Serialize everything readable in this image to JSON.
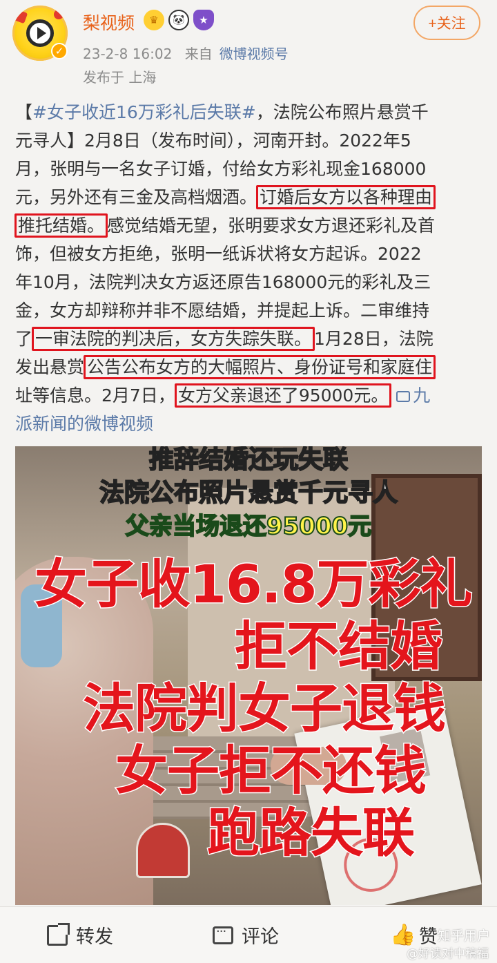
{
  "header": {
    "account_name": "梨视频",
    "verified_mark": "✓",
    "badge_icons": [
      "crown-icon",
      "panda-icon",
      "shield-icon"
    ],
    "timestamp": "23-2-8 16:02",
    "source_prefix": "来自",
    "source": "微博视频号",
    "location": "发布于 上海",
    "follow_label": "+关注"
  },
  "post": {
    "line1_pre": "【",
    "line1_tag": "#女子收近16万彩礼后失联#",
    "line1_post": "，法院公布照片悬赏千",
    "line2": "元寻人】2月8日（发布时间），河南开封。2022年5",
    "line3": "月，张明与一名女子订婚，付给女方彩礼现金168000",
    "line4_pre": "元，另外还有三金及高档烟酒。",
    "line4_hl": "订婚后女方以各种理由",
    "line5_hl": "推托结婚。",
    "line5_post": "感觉结婚无望，张明要求女方退还彩礼及首",
    "line6": "饰，但被女方拒绝，张明一纸诉状将女方起诉。2022",
    "line7": "年10月，法院判决女方返还原告168000元的彩礼及三",
    "line8": "金，女方却辩称并非不愿结婚，并提起上诉。二审维持",
    "line9_pre": "了",
    "line9_hl": "一审法院的判决后，女方失踪失联。",
    "line9_post": "1月28日，法院",
    "line10_pre": "发出悬赏",
    "line10_hl": "公告公布女方的大幅照片、身份证号和家庭住",
    "line11_pre": "址等信息。2月7日，",
    "line11_hl": "女方父亲退还了95000元。",
    "line11_link": "九",
    "line12_link": "派新闻的微博视频"
  },
  "media": {
    "caption1": "推辞结婚还玩失联",
    "caption2": "法院公布照片悬赏千元寻人",
    "caption3": "父亲当场退还95000元",
    "big1": "女子收16.8万彩礼",
    "big2": "拒不结婚",
    "big3": "法院判女子退钱",
    "big4": "女子拒不还钱",
    "big5": "跑路失联"
  },
  "actions": {
    "forward": "转发",
    "comment": "评论",
    "like": "赞"
  },
  "watermark": {
    "line1": "知乎用户",
    "line2": "@好读对中稿福"
  },
  "colors": {
    "highlight_box": "#e0141e",
    "link": "#5b7aa8",
    "account_name": "#e8621a",
    "big_text": "#e4151c"
  }
}
